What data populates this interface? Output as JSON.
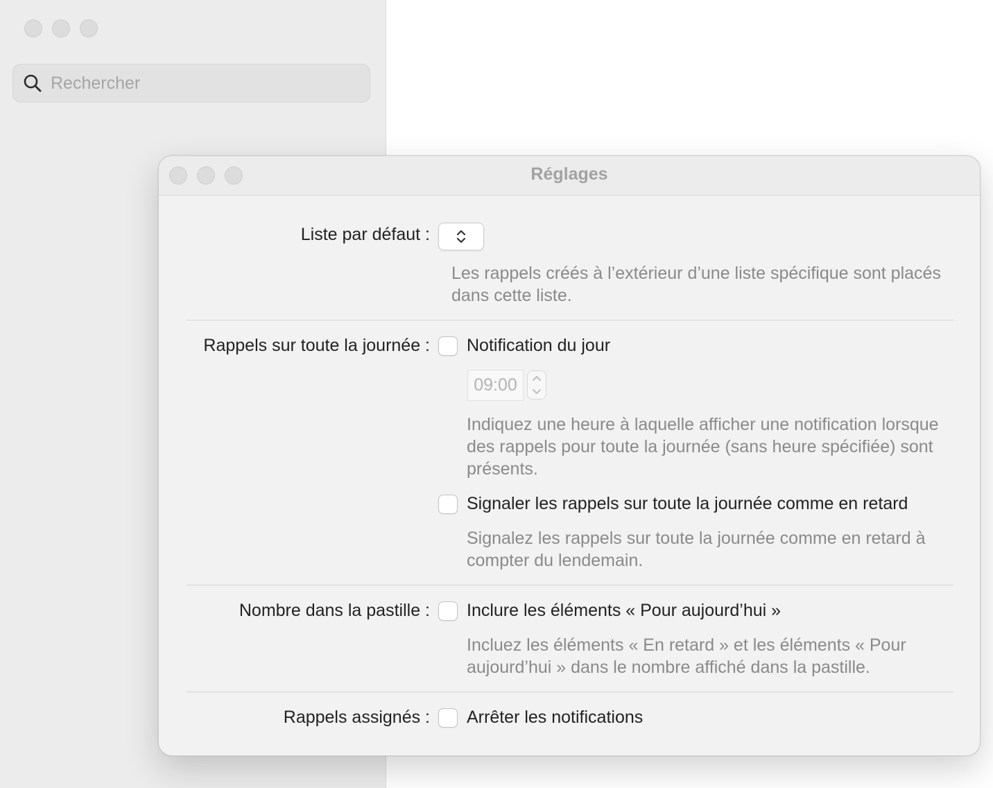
{
  "background_app": {
    "search": {
      "placeholder": "Rechercher",
      "icon": "search-icon"
    }
  },
  "settings_window": {
    "title": "Réglages",
    "default_list": {
      "label": "Liste par défaut :",
      "selected_value": "",
      "help": "Les rappels créés à l’extérieur d’une liste spécifique sont placés dans cette liste."
    },
    "all_day": {
      "label": "Rappels sur toute la journée :",
      "notification_option": "Notification du jour",
      "notification_checked": false,
      "time_value": "09:00",
      "time_help": "Indiquez une heure à laquelle afficher une notification lorsque des rappels pour toute la journée (sans heure spécifiée) sont présents.",
      "overdue_option": "Signaler les rappels sur toute la journée comme en retard",
      "overdue_checked": false,
      "overdue_help": "Signalez les rappels sur toute la journée comme en retard à compter du lendemain."
    },
    "badge_count": {
      "label": "Nombre dans la pastille :",
      "include_today_option": "Inclure les éléments « Pour aujourd’hui »",
      "include_today_checked": false,
      "help": "Incluez les éléments « En retard » et les éléments « Pour aujourd’hui » dans le nombre affiché dans la pastille."
    },
    "assigned": {
      "label": "Rappels assignés :",
      "mute_option": "Arrêter les notifications",
      "mute_checked": false
    }
  },
  "colors": {
    "window_bg": "#f2f2f2",
    "help_text": "#8a8a8a",
    "title_text": "#a2a2a2"
  }
}
